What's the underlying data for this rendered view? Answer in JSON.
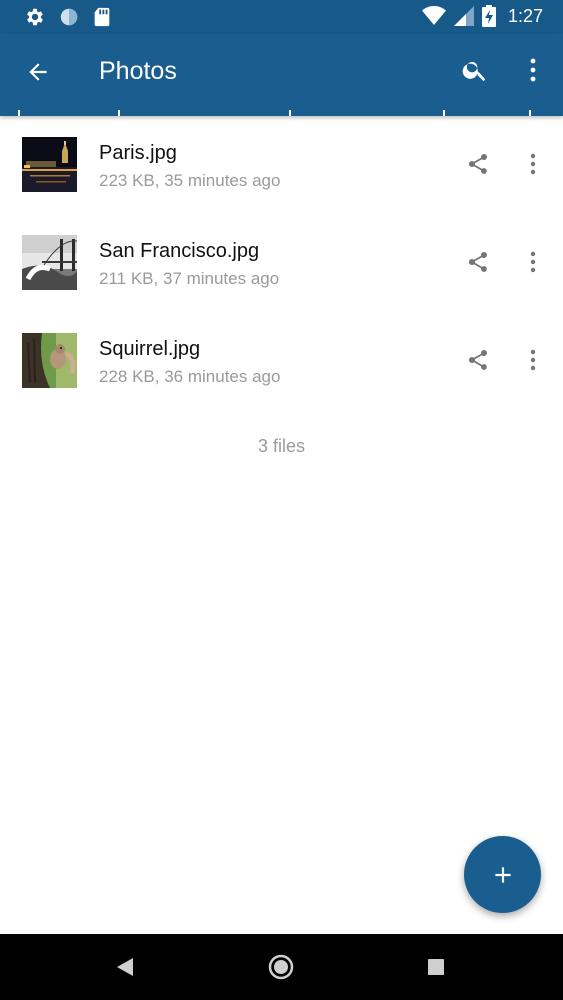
{
  "status_bar": {
    "time": "1:27",
    "icons_left": [
      "settings-icon",
      "sync-icon",
      "sd-card-icon"
    ],
    "icons_right": [
      "wifi-icon",
      "signal-icon",
      "battery-charging-icon"
    ]
  },
  "app_bar": {
    "title": "Photos",
    "back_icon": "arrow-back-icon",
    "search_icon": "search-icon",
    "overflow_icon": "more-vert-icon"
  },
  "files": [
    {
      "name": "Paris.jpg",
      "meta": "223 KB, 35 minutes ago",
      "thumb": "paris-night"
    },
    {
      "name": "San Francisco.jpg",
      "meta": "211 KB, 37 minutes ago",
      "thumb": "golden-gate-bw"
    },
    {
      "name": "Squirrel.jpg",
      "meta": "228 KB, 36 minutes ago",
      "thumb": "squirrel"
    }
  ],
  "files_count": "3 files",
  "fab": {
    "icon": "plus-icon"
  },
  "colors": {
    "primary": "#1a5e90",
    "status_bar": "#175a8a",
    "secondary_text": "#9a9a9a"
  },
  "nav_bar": {
    "icons": [
      "back-triangle-icon",
      "home-circle-icon",
      "recents-square-icon"
    ]
  }
}
